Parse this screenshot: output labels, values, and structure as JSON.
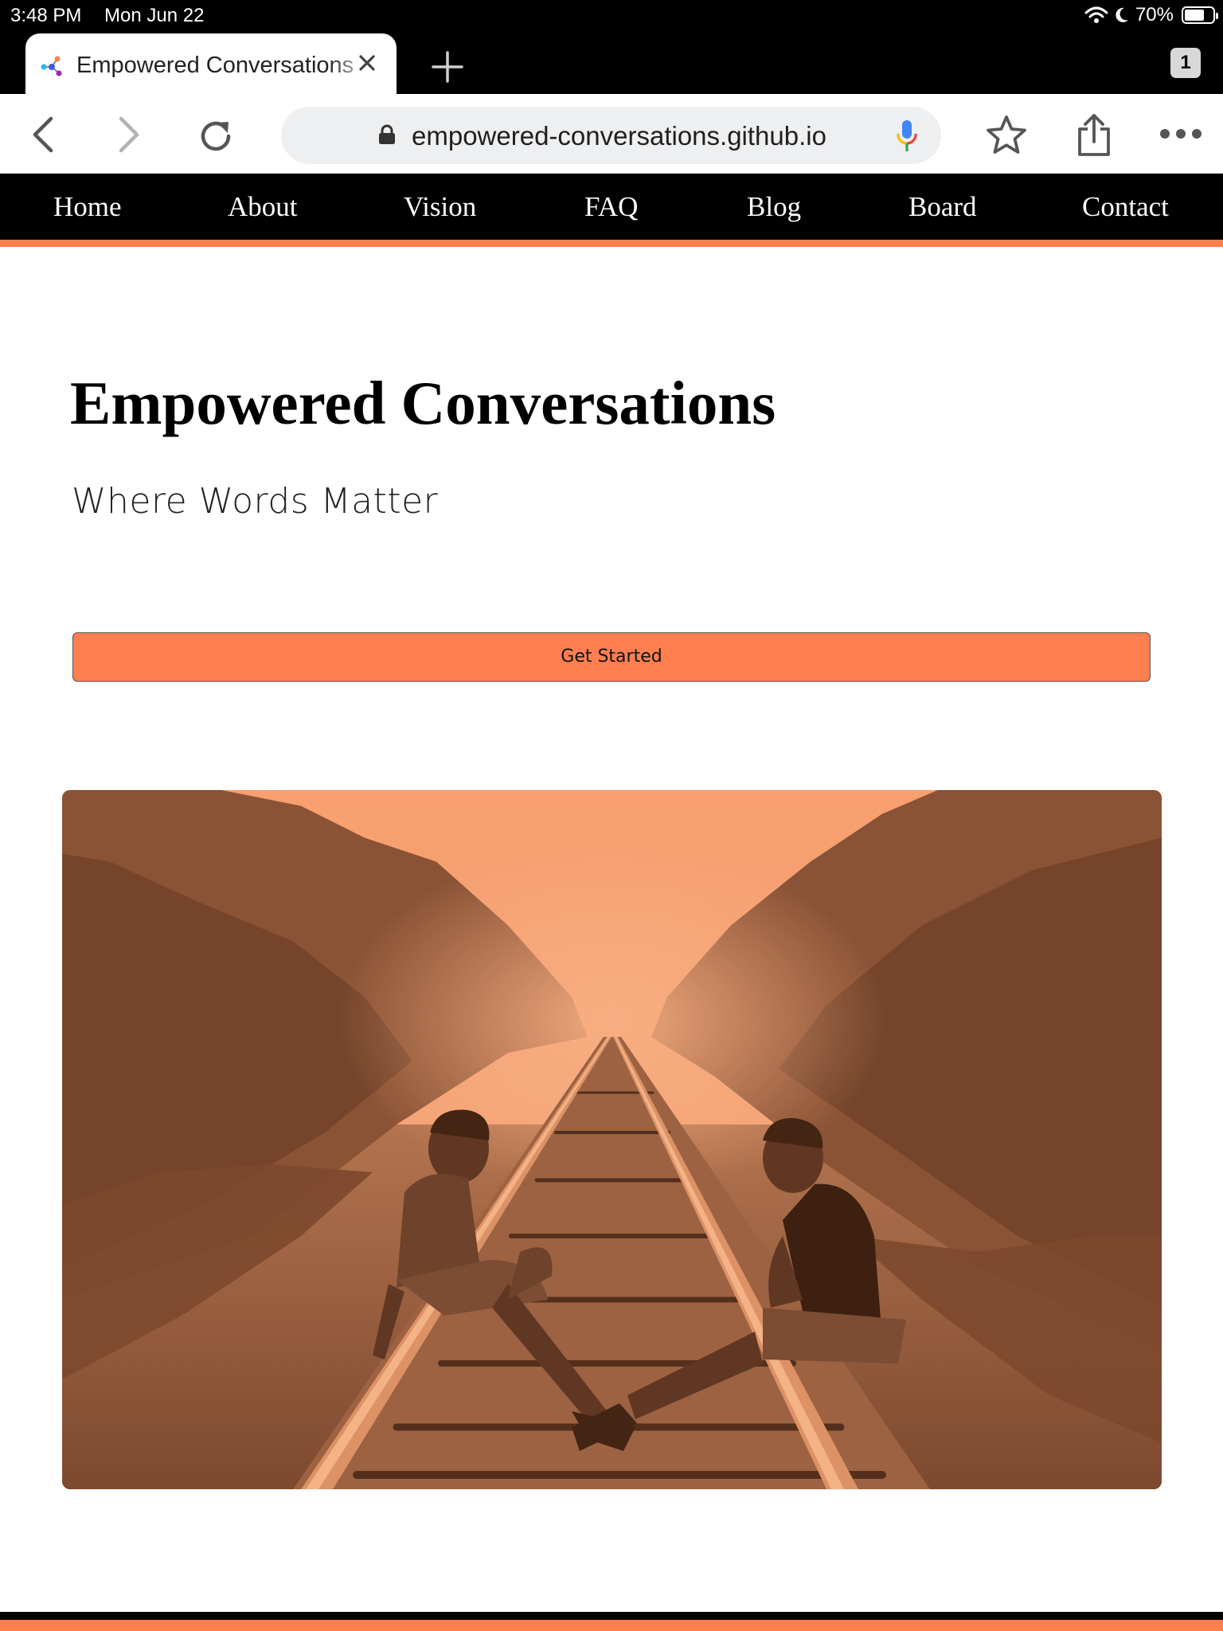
{
  "status": {
    "time": "3:48 PM",
    "date": "Mon Jun 22",
    "battery": "70%"
  },
  "tabs": {
    "active_title": "Empowered Conversations",
    "count": "1"
  },
  "toolbar": {
    "url": "empowered-conversations.github.io"
  },
  "nav": {
    "items": [
      "Home",
      "About",
      "Vision",
      "FAQ",
      "Blog",
      "Board",
      "Contact"
    ]
  },
  "hero": {
    "title": "Empowered Conversations",
    "subtitle": "Where Words Matter",
    "cta_label": "Get Started"
  },
  "colors": {
    "accent": "#ff7f50",
    "nav_bg": "#000000"
  },
  "icons": {
    "back": "chevron-left-icon",
    "forward": "chevron-right-icon",
    "reload": "reload-icon",
    "bookmark": "star-icon",
    "share": "share-icon",
    "menu": "more-horizontal-icon",
    "lock": "lock-icon",
    "mic": "mic-icon",
    "wifi": "wifi-icon",
    "moon": "moon-icon"
  }
}
